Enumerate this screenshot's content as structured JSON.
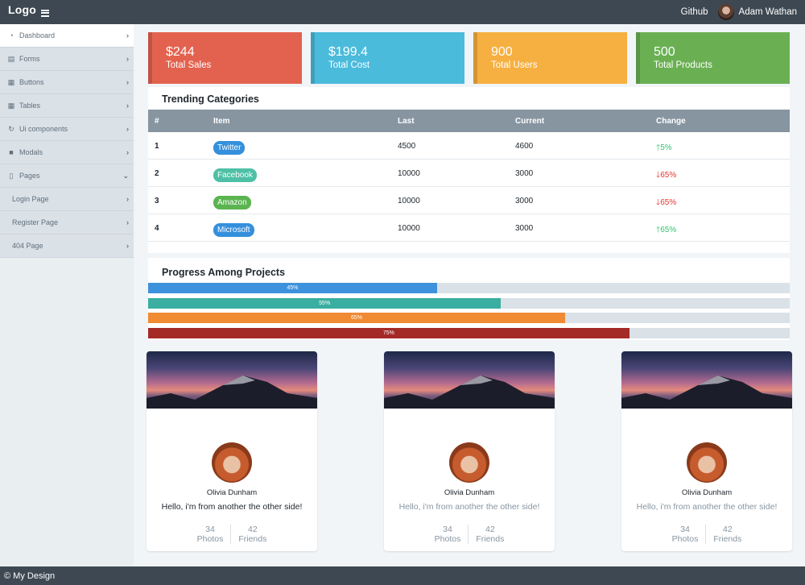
{
  "header": {
    "logo": "Logo",
    "github": "Github",
    "user_name": "Adam Wathan"
  },
  "sidebar": {
    "items": [
      {
        "label": "Dashboard",
        "icon": "dashboard-icon"
      },
      {
        "label": "Forms",
        "icon": "form-icon"
      },
      {
        "label": "Buttons",
        "icon": "grid-icon"
      },
      {
        "label": "Tables",
        "icon": "table-icon"
      },
      {
        "label": "Ui components",
        "icon": "spinner-icon"
      },
      {
        "label": "Modals",
        "icon": "square-icon"
      },
      {
        "label": "Pages",
        "icon": "file-icon"
      }
    ],
    "subitems": [
      {
        "label": "Login Page"
      },
      {
        "label": "Register Page"
      },
      {
        "label": "404 Page"
      }
    ]
  },
  "stats": [
    {
      "value": "$244",
      "label": "Total Sales",
      "color": "#e3624f"
    },
    {
      "value": "$199.4",
      "label": "Total Cost",
      "color": "#4bbbdc"
    },
    {
      "value": "900",
      "label": "Total Users",
      "color": "#f6b041"
    },
    {
      "value": "500",
      "label": "Total Products",
      "color": "#6ab053"
    }
  ],
  "trending": {
    "title": "Trending Categories",
    "headers": [
      "#",
      "Item",
      "Last",
      "Current",
      "Change"
    ],
    "rows": [
      {
        "num": "1",
        "item": "Twitter",
        "pill_color": "#3490dc",
        "last": "4500",
        "current": "4600",
        "change": "5%",
        "dir": "up"
      },
      {
        "num": "2",
        "item": "Facebook",
        "pill_color": "#4dc0a5",
        "last": "10000",
        "current": "3000",
        "change": "65%",
        "dir": "down"
      },
      {
        "num": "3",
        "item": "Amazon",
        "pill_color": "#5bb450",
        "last": "10000",
        "current": "3000",
        "change": "65%",
        "dir": "down"
      },
      {
        "num": "4",
        "item": "Microsoft",
        "pill_color": "#3490dc",
        "last": "10000",
        "current": "3000",
        "change": "65%",
        "dir": "up"
      }
    ]
  },
  "progress": {
    "title": "Progress Among Projects",
    "bars": [
      {
        "label": "45%",
        "value": 0.45,
        "color": "#3e92dd"
      },
      {
        "label": "55%",
        "value": 0.55,
        "color": "#3aaea0"
      },
      {
        "label": "65%",
        "value": 0.65,
        "color": "#f08a33"
      },
      {
        "label": "75%",
        "value": 0.75,
        "color": "#a42a28"
      }
    ]
  },
  "profiles": [
    {
      "name": "Olivia Dunham",
      "message": "Hello, i'm from another the other side!",
      "photos_count": "34",
      "photos_label": "Photos",
      "friends_count": "42",
      "friends_label": "Friends"
    },
    {
      "name": "Olivia Dunham",
      "message": "Hello, i'm from another the other side!",
      "photos_count": "34",
      "photos_label": "Photos",
      "friends_count": "42",
      "friends_label": "Friends"
    },
    {
      "name": "Olivia Dunham",
      "message": "Hello, i'm from another the other side!",
      "photos_count": "34",
      "photos_label": "Photos",
      "friends_count": "42",
      "friends_label": "Friends"
    }
  ],
  "footer": {
    "text": "© My Design"
  }
}
